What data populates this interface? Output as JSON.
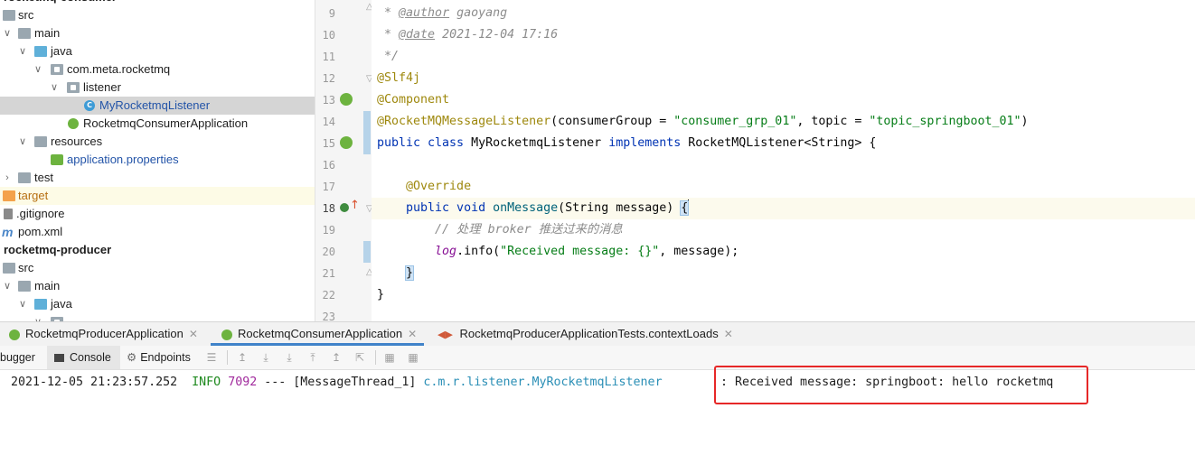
{
  "project_tree": {
    "consumer_root": "rocketmq-consumer",
    "items": [
      {
        "label": "src"
      },
      {
        "label": "main"
      },
      {
        "label": "java"
      },
      {
        "label": "com.meta.rocketmq"
      },
      {
        "label": "listener"
      },
      {
        "label": "MyRocketmqListener"
      },
      {
        "label": "RocketmqConsumerApplication"
      },
      {
        "label": "resources"
      },
      {
        "label": "application.properties"
      },
      {
        "label": "test"
      },
      {
        "label": "target"
      },
      {
        "label": ".gitignore"
      },
      {
        "label": "pom.xml"
      },
      {
        "label": "rocketmq-producer"
      },
      {
        "label": "src"
      },
      {
        "label": "main"
      },
      {
        "label": "java"
      }
    ],
    "icons": {
      "class_letter": "C",
      "maven_letter": "m"
    }
  },
  "editor": {
    "line_numbers": [
      "9",
      "10",
      "11",
      "12",
      "13",
      "14",
      "15",
      "16",
      "17",
      "18",
      "19",
      "20",
      "21",
      "22",
      "23"
    ],
    "code": {
      "l9_star": " * ",
      "l9_tag": "@author",
      "l9_rest": " gaoyang",
      "l10_star": " * ",
      "l10_tag": "@date",
      "l10_rest": " 2021-12-04 17:16",
      "l11": " */",
      "l12": "@Slf4j",
      "l13": "@Component",
      "l14_ann": "@RocketMQMessageListener",
      "l14_a": "(consumerGroup = ",
      "l14_s1": "\"consumer_grp_01\"",
      "l14_b": ", topic = ",
      "l14_s2": "\"topic_springboot_01\"",
      "l14_c": ")",
      "l15_kw1": "public class",
      "l15_a": " MyRocketmqListener ",
      "l15_kw2": "implements",
      "l15_b": " RocketMQListener<String> {",
      "l17": "    @Override",
      "l18_kw": "    public void",
      "l18_fn": " onMessage",
      "l18_a": "(String message) ",
      "l18_brace": "{",
      "l19": "        // 处理 broker 推送过来的消息",
      "l20_fld": "        log",
      "l20_a": ".info(",
      "l20_s": "\"Received message: {}\"",
      "l20_b": ", message);",
      "l21_pad": "    ",
      "l21_brace": "}",
      "l22": "}"
    }
  },
  "run_tabs": [
    {
      "label": "RocketmqProducerApplication"
    },
    {
      "label": "RocketmqConsumerApplication"
    },
    {
      "label": "RocketmqProducerApplicationTests.contextLoads"
    }
  ],
  "console_toolbar": {
    "debugger": "bugger",
    "console": "Console",
    "endpoints": "Endpoints"
  },
  "console": {
    "timestamp": "2021-12-05 21:23:57.252",
    "level": "INFO",
    "pid": "7092",
    "sep": "---",
    "thread": "[MessageThread_1]",
    "logger": "c.m.r.listener.MyRocketmqListener",
    "message": ": Received message: springboot: hello rocketmq"
  },
  "colors": {
    "annotation": "#9e880d",
    "keyword": "#0033b3",
    "string": "#067d17",
    "highlight_box": "#e62828",
    "selected_row": "#d5d5d5"
  }
}
